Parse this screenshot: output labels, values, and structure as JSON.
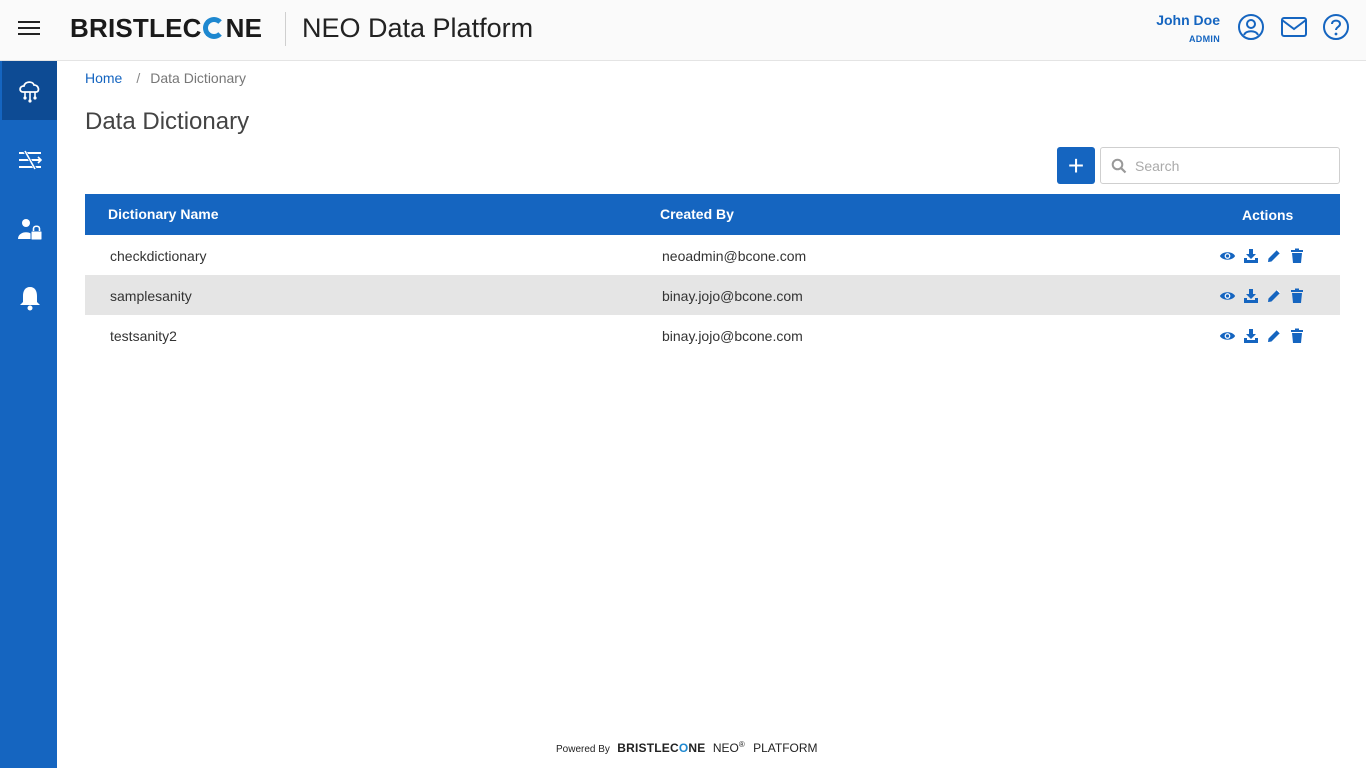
{
  "header": {
    "logo": {
      "pre": "BRISTLEC",
      "post": "NE"
    },
    "app_title": "NEO Data Platform",
    "user_name": "John Doe",
    "user_role": "ADMIN"
  },
  "breadcrumb": {
    "home": "Home",
    "separator": "/",
    "current": "Data Dictionary"
  },
  "page_title": "Data Dictionary",
  "toolbar": {
    "add_label": "+",
    "search_placeholder": "Search"
  },
  "table": {
    "columns": [
      "Dictionary Name",
      "Created By",
      "Actions"
    ],
    "rows": [
      {
        "name": "checkdictionary",
        "created_by": "neoadmin@bcone.com"
      },
      {
        "name": "samplesanity",
        "created_by": "binay.jojo@bcone.com"
      },
      {
        "name": "testsanity2",
        "created_by": "binay.jojo@bcone.com"
      }
    ]
  },
  "footer": {
    "powered_by": "Powered By",
    "brand_pre": "BRISTLEC",
    "brand_post": "NE",
    "neo": "NEO",
    "reg": "®",
    "platform": "PLATFORM"
  },
  "colors": {
    "primary": "#1565c0",
    "sidebar_active": "#0d4b94",
    "row_alt": "#e5e5e5",
    "brand_accent": "#1e88d0"
  },
  "icons": {
    "sidebar": [
      "cloud-network-icon",
      "pipeline-icon",
      "user-lock-icon",
      "bell-icon"
    ],
    "header": [
      "user-circle-icon",
      "mail-icon",
      "help-icon"
    ],
    "row_actions": [
      "eye-icon",
      "download-icon",
      "pencil-icon",
      "trash-icon"
    ]
  }
}
